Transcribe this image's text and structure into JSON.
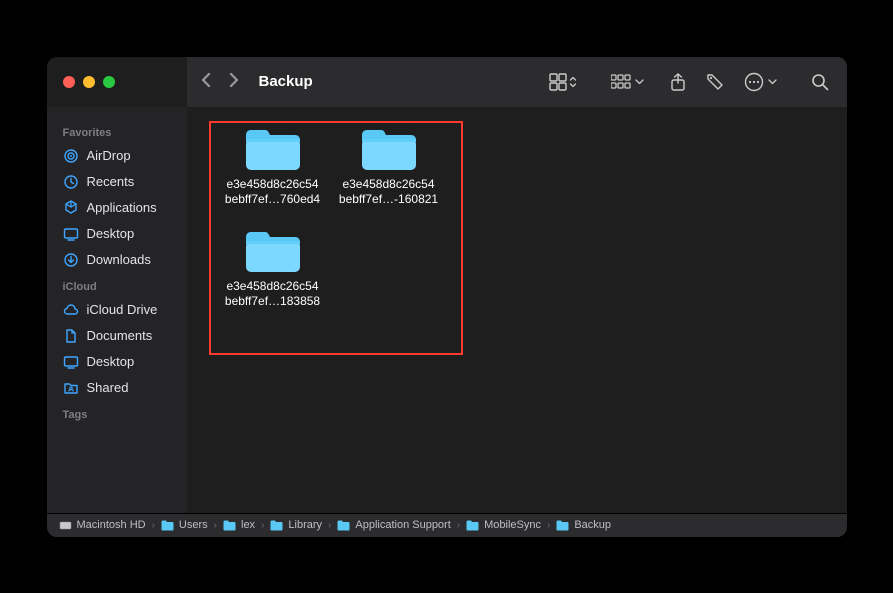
{
  "title": "Backup",
  "sidebar": {
    "sections": [
      {
        "header": "Favorites",
        "items": [
          {
            "label": "AirDrop",
            "icon": "airdrop"
          },
          {
            "label": "Recents",
            "icon": "clock"
          },
          {
            "label": "Applications",
            "icon": "apps"
          },
          {
            "label": "Desktop",
            "icon": "desktop"
          },
          {
            "label": "Downloads",
            "icon": "downloads"
          }
        ]
      },
      {
        "header": "iCloud",
        "items": [
          {
            "label": "iCloud Drive",
            "icon": "icloud"
          },
          {
            "label": "Documents",
            "icon": "documents"
          },
          {
            "label": "Desktop",
            "icon": "desktop"
          },
          {
            "label": "Shared",
            "icon": "shared"
          }
        ]
      },
      {
        "header": "Tags",
        "items": []
      }
    ]
  },
  "folders": [
    {
      "line1": "e3e458d8c26c54",
      "line2": "bebff7ef…760ed4"
    },
    {
      "line1": "e3e458d8c26c54",
      "line2": "bebff7ef…-160821"
    },
    {
      "line1": "e3e458d8c26c54",
      "line2": "bebff7ef…183858"
    }
  ],
  "pathbar": [
    {
      "label": "Macintosh HD",
      "icon": "disk"
    },
    {
      "label": "Users",
      "icon": "folder"
    },
    {
      "label": "lex",
      "icon": "folder"
    },
    {
      "label": "Library",
      "icon": "folder"
    },
    {
      "label": "Application Support",
      "icon": "folder"
    },
    {
      "label": "MobileSync",
      "icon": "folder"
    },
    {
      "label": "Backup",
      "icon": "folder"
    }
  ]
}
